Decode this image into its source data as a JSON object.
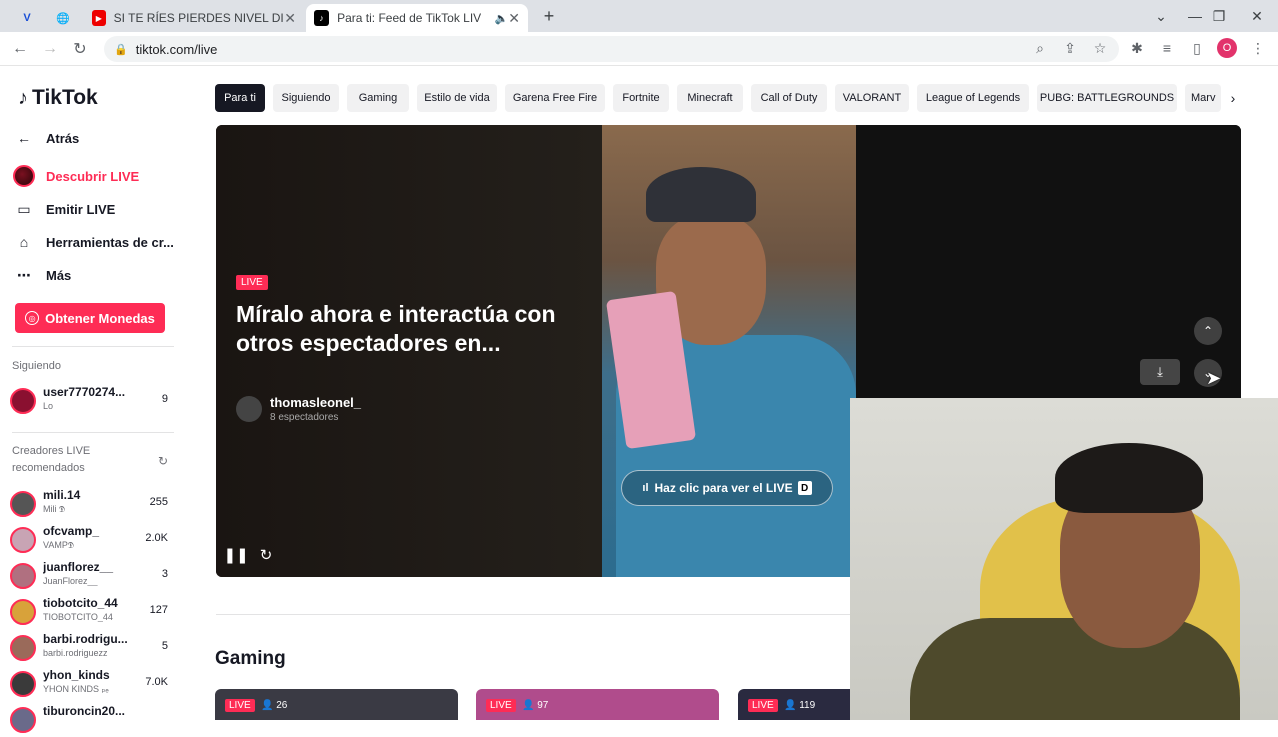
{
  "browser": {
    "tabs": [
      {
        "title": "",
        "icon": "v-logo-icon",
        "active": false
      },
      {
        "title": "",
        "icon": "globe-icon",
        "active": false
      },
      {
        "title": "SI TE RÍES PIERDES NIVEL DIOS😆",
        "icon": "youtube-icon",
        "active": false
      },
      {
        "title": "Para ti: Feed de TikTok LIVE",
        "icon": "tiktok-icon",
        "active": true
      }
    ],
    "url": "tiktok.com/live",
    "profile_initial": "O"
  },
  "sidebar": {
    "logo_text": "TikTok",
    "back_label": "Atrás",
    "nav": [
      {
        "label": "Descubrir LIVE",
        "icon": "live-avatar-icon",
        "active": true
      },
      {
        "label": "Emitir LIVE",
        "icon": "video-camera-icon",
        "active": false
      },
      {
        "label": "Herramientas de cr...",
        "icon": "home-tools-icon",
        "active": false
      },
      {
        "label": "Más",
        "icon": "more-dots-icon",
        "active": false
      }
    ],
    "coins_label": "Obtener Monedas",
    "following_label": "Siguiendo",
    "following": [
      {
        "name": "user7770274...",
        "sub": "Lo",
        "count": "9"
      }
    ],
    "recommended_label": "Creadores LIVE recomendados",
    "creators": [
      {
        "name": "mili.14",
        "sub": "Mili 𝕯",
        "count": "255"
      },
      {
        "name": "ofcvamp_",
        "sub": "VAMP𝕯",
        "count": "2.0K"
      },
      {
        "name": "juanflorez__",
        "sub": "JuanFlorez__",
        "count": "3"
      },
      {
        "name": "tiobotcito_44",
        "sub": "TIOBOTCITO_44",
        "count": "127"
      },
      {
        "name": "barbi.rodrigu...",
        "sub": "barbi.rodriguezz",
        "count": "5"
      },
      {
        "name": "yhon_kinds",
        "sub": "YHON KINDS ₚₑ",
        "count": "7.0K"
      },
      {
        "name": "tiburoncin20...",
        "sub": "",
        "count": ""
      }
    ]
  },
  "categories": [
    "Para ti",
    "Siguiendo",
    "Gaming",
    "Estilo de vida",
    "Garena Free Fire",
    "Fortnite",
    "Minecraft",
    "Call of Duty",
    "VALORANT",
    "League of Legends",
    "PUBG: BATTLEGROUNDS",
    "Marv"
  ],
  "hero": {
    "live_badge": "LIVE",
    "title": "Míralo ahora e interactúa con otros espectadores en...",
    "host": "thomasleonel_",
    "viewers": "8 espectadores",
    "cta": "Haz clic para ver el LIVE",
    "cta_key": "D"
  },
  "gaming": {
    "title": "Gaming",
    "cards": [
      {
        "badge": "LIVE",
        "viewers": "26"
      },
      {
        "badge": "LIVE",
        "viewers": "97"
      },
      {
        "badge": "LIVE",
        "viewers": "119"
      }
    ]
  },
  "colors": {
    "brand": "#fe2c55",
    "dark": "#161823"
  }
}
